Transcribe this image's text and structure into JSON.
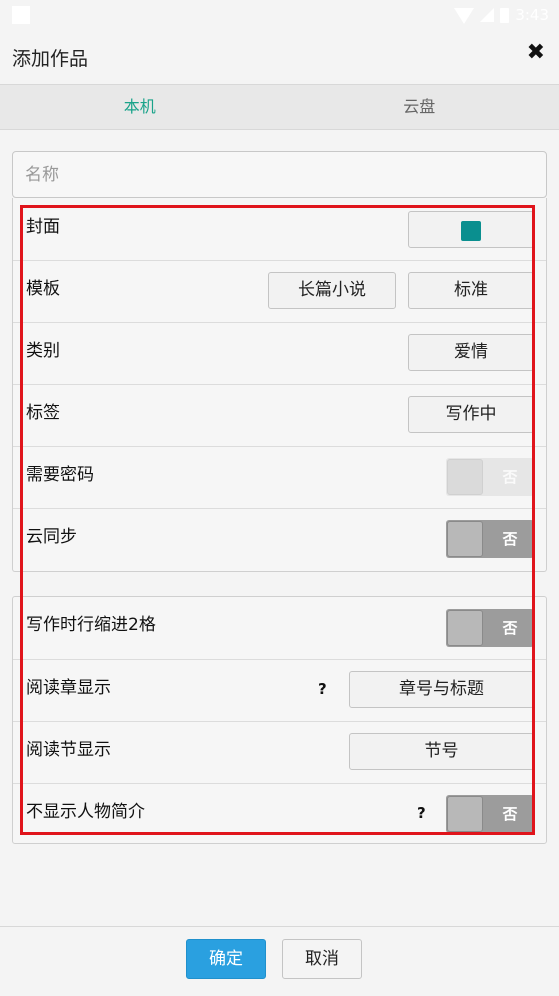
{
  "status_bar": {
    "time": "3:43",
    "icons": [
      "wifi-icon",
      "signal-icon",
      "battery-icon"
    ]
  },
  "header": {
    "title": "添加作品",
    "close_icon": "close-icon"
  },
  "tabs": [
    {
      "label": "本机",
      "active": true
    },
    {
      "label": "云盘",
      "active": false
    }
  ],
  "name_field": {
    "placeholder": "名称",
    "value": ""
  },
  "settings": {
    "cover": {
      "label": "封面",
      "swatch_color": "#0a8f8f"
    },
    "template": {
      "label": "模板",
      "option1": "长篇小说",
      "option2": "标准"
    },
    "category": {
      "label": "类别",
      "value": "爱情"
    },
    "tag": {
      "label": "标签",
      "value": "写作中"
    },
    "password": {
      "label": "需要密码",
      "toggle": "否",
      "enabled": false
    },
    "cloud_sync": {
      "label": "云同步",
      "toggle": "否"
    }
  },
  "writing": {
    "indent": {
      "label": "写作时行缩进2格",
      "toggle": "否"
    },
    "chapter_display": {
      "label": "阅读章显示",
      "help": "?",
      "value": "章号与标题"
    },
    "section_display": {
      "label": "阅读节显示",
      "value": "节号"
    },
    "hide_character": {
      "label": "不显示人物简介",
      "help": "?",
      "toggle": "否"
    }
  },
  "footer": {
    "ok": "确定",
    "cancel": "取消",
    "ok_color": "#2aa0e0"
  },
  "accent_color": "#1aa38a",
  "annotation_color": "#e0141b"
}
